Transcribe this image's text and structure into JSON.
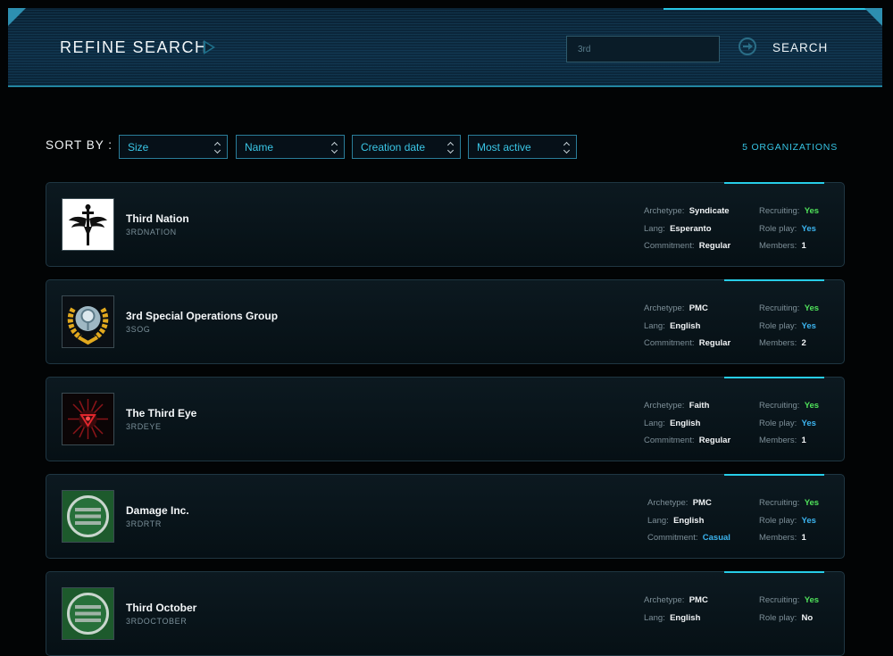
{
  "header": {
    "title": "REFINE SEARCH",
    "search_value": "3rd",
    "search_label": "SEARCH"
  },
  "sort": {
    "label": "SORT BY :",
    "options": [
      "Size",
      "Name",
      "Creation date",
      "Most active"
    ]
  },
  "results_count": "5 ORGANIZATIONS",
  "labels": {
    "archetype": "Archetype:",
    "lang": "Lang:",
    "commitment": "Commitment:",
    "recruiting": "Recruiting:",
    "roleplay": "Role play:",
    "members": "Members:"
  },
  "colors": {
    "accent": "#27cde8",
    "yes_green": "#4fe05a",
    "yes_blue": "#3cb4ef"
  },
  "orgs": [
    {
      "name": "Third Nation",
      "sid": "3RDNATION",
      "archetype": "Syndicate",
      "lang": "Esperanto",
      "commitment": "Regular",
      "recruiting": "Yes",
      "roleplay": "Yes",
      "members": "1",
      "logo": "winged-sword-icon"
    },
    {
      "name": "3rd Special Operations Group",
      "sid": "3SOG",
      "archetype": "PMC",
      "lang": "English",
      "commitment": "Regular",
      "recruiting": "Yes",
      "roleplay": "Yes",
      "members": "2",
      "logo": "laurel-globe-icon"
    },
    {
      "name": "The Third Eye",
      "sid": "3RDEYE",
      "archetype": "Faith",
      "lang": "English",
      "commitment": "Regular",
      "recruiting": "Yes",
      "roleplay": "Yes",
      "members": "1",
      "logo": "red-eye-icon"
    },
    {
      "name": "Damage Inc.",
      "sid": "3RDRTR",
      "archetype": "PMC",
      "lang": "English",
      "commitment": "Casual",
      "recruiting": "Yes",
      "roleplay": "Yes",
      "members": "1",
      "logo": "green-stripes-icon"
    },
    {
      "name": "Third October",
      "sid": "3RDOCTOBER",
      "archetype": "PMC",
      "lang": "English",
      "commitment": "",
      "recruiting": "Yes",
      "roleplay": "No",
      "members": "",
      "logo": "green-stripes-icon"
    }
  ]
}
